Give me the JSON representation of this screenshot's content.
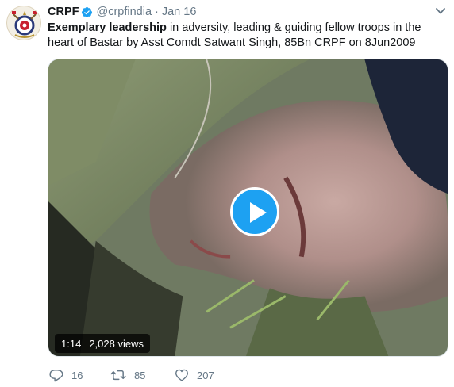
{
  "tweet": {
    "author_name": "CRPF",
    "handle": "@crpfindia",
    "separator": "·",
    "date": "Jan 16",
    "text_bold": "Exemplary leadership",
    "text_rest": " in adversity, leading & guiding fellow troops in the heart of Bastar by Asst Comdt Satwant Singh, 85Bn CRPF on 8Jun2009"
  },
  "video": {
    "duration": "1:14",
    "views": "2,028 views"
  },
  "actions": {
    "replies": "16",
    "retweets": "85",
    "likes": "207"
  },
  "colors": {
    "accent": "#1da1f2",
    "secondary_text": "#657786",
    "primary_text": "#14171a"
  },
  "icons": {
    "verified": "verified-badge-icon",
    "menu": "chevron-down-icon",
    "play": "play-icon",
    "reply": "reply-icon",
    "retweet": "retweet-icon",
    "like": "heart-icon"
  }
}
